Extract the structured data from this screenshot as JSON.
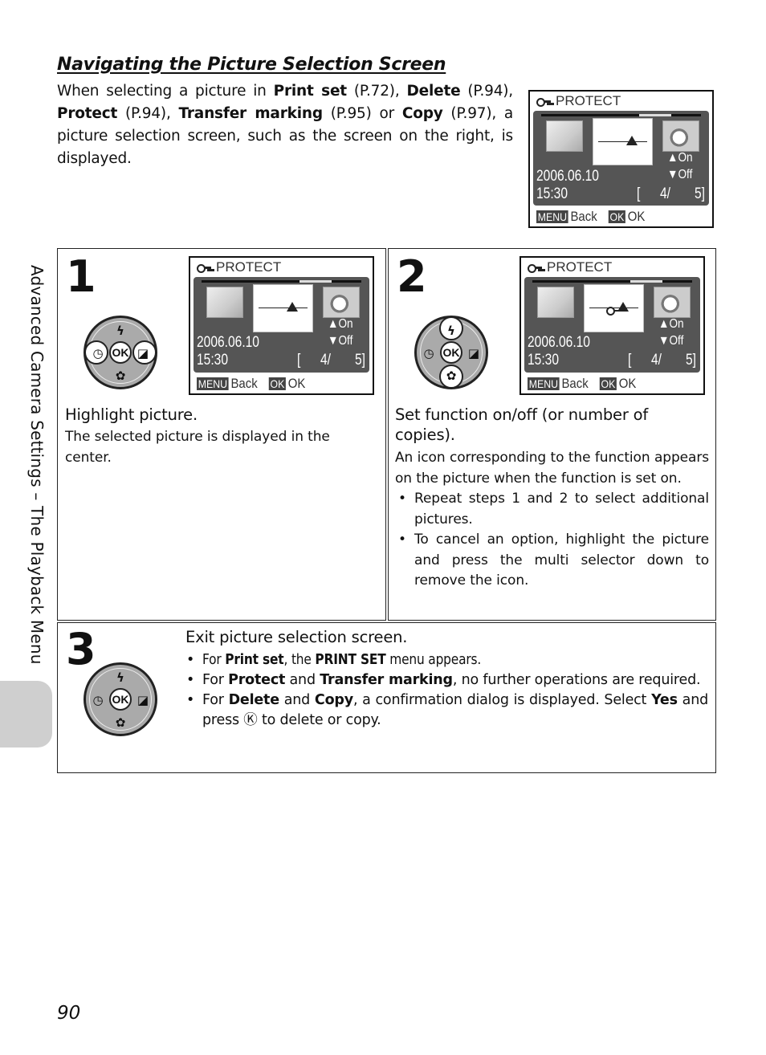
{
  "section": {
    "title": "Navigating the Picture Selection Screen",
    "intro": [
      {
        "t": "When selecting a picture in ",
        "b": false
      },
      {
        "t": "Print set",
        "b": true
      },
      {
        "t": " (P.72), ",
        "b": false
      },
      {
        "t": "Delete",
        "b": true
      },
      {
        "t": " (P.94), ",
        "b": false
      },
      {
        "t": "Protect",
        "b": true
      },
      {
        "t": " (P.94), ",
        "b": false
      },
      {
        "t": "Transfer marking",
        "b": true
      },
      {
        "t": " (P.95) or ",
        "b": false
      },
      {
        "t": "Copy",
        "b": true
      },
      {
        "t": " (P.97), a picture selection screen, such as the screen on the right, is displayed.",
        "b": false
      }
    ]
  },
  "camera_screen": {
    "mode_icon": "key-icon",
    "title": "PROTECT",
    "date": "2006.06.10",
    "time": "15:30",
    "counter_open": "[",
    "counter_current": "4/",
    "counter_total": "5]",
    "on_label": "On",
    "off_label": "Off",
    "menu_tag": "MENU",
    "back_label": "Back",
    "ok_tag": "OK",
    "ok_label": "OK"
  },
  "dial": {
    "ok_label": "OK",
    "up_icon": "flash-icon",
    "down_icon": "macro-icon",
    "left_icon": "self-timer-icon",
    "right_icon": "exposure-comp-icon",
    "up_glyph": "ϟ",
    "down_glyph": "✿",
    "left_glyph": "◷",
    "right_glyph": "◪"
  },
  "steps": [
    {
      "number": "1",
      "title": "Highlight picture.",
      "body": "The selected picture is displayed in the center."
    },
    {
      "number": "2",
      "title": "Set function on/off (or number of copies).",
      "body": "An icon corresponding to the function appears on the picture when the function is set on.",
      "bullets": [
        "Repeat steps 1 and 2 to select additional pictures.",
        "To cancel an option, highlight the picture and press the multi selector down to remove the icon."
      ]
    },
    {
      "number": "3",
      "title": "Exit picture selection screen.",
      "bullets": [
        [
          {
            "t": "For ",
            "b": false
          },
          {
            "t": "Print set",
            "b": true
          },
          {
            "t": ", the ",
            "b": false
          },
          {
            "t": "PRINT SET",
            "b": true
          },
          {
            "t": " menu appears.",
            "b": false
          }
        ],
        [
          {
            "t": "For ",
            "b": false
          },
          {
            "t": "Protect",
            "b": true
          },
          {
            "t": " and ",
            "b": false
          },
          {
            "t": "Transfer marking",
            "b": true
          },
          {
            "t": ", no further operations are required.",
            "b": false
          }
        ],
        [
          {
            "t": "For ",
            "b": false
          },
          {
            "t": "Delete",
            "b": true
          },
          {
            "t": " and ",
            "b": false
          },
          {
            "t": "Copy",
            "b": true
          },
          {
            "t": ", a confirmation dialog is displayed. Select ",
            "b": false
          },
          {
            "t": "Yes",
            "b": true
          },
          {
            "t": " and press ",
            "b": false
          },
          {
            "t": "Ⓚ",
            "b": false
          },
          {
            "t": " to delete or copy.",
            "b": false
          }
        ]
      ]
    }
  ],
  "side_label": "Advanced Camera Settings – The Playback Menu",
  "page_number": "90"
}
